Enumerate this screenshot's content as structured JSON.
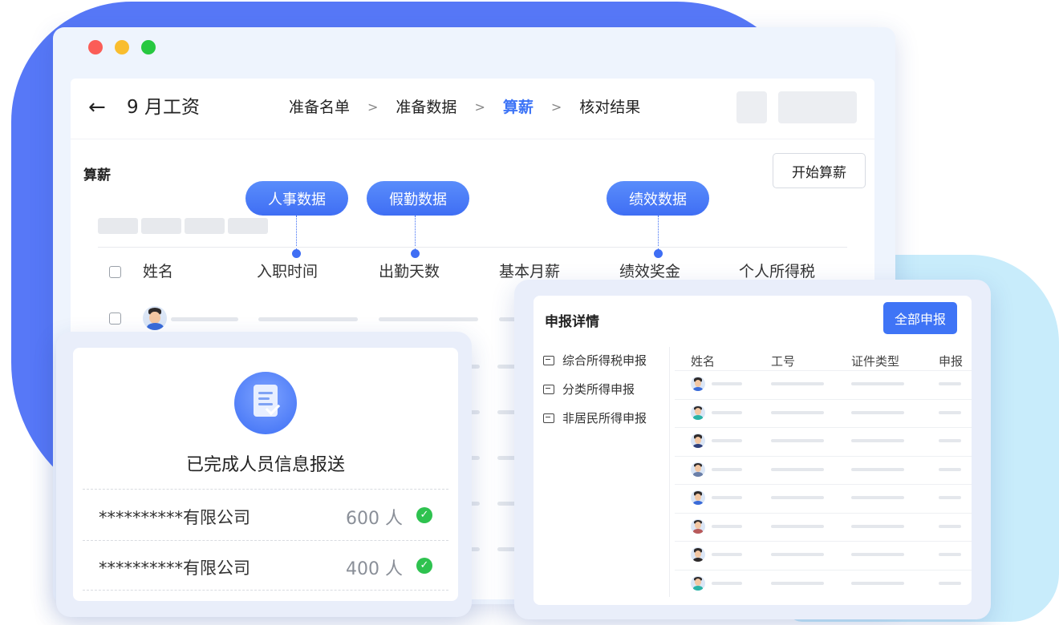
{
  "header": {
    "back_icon": "←",
    "title": "9 月工资",
    "steps": [
      {
        "label": "准备名单",
        "active": false
      },
      {
        "label": "准备数据",
        "active": false
      },
      {
        "label": "算薪",
        "active": true
      },
      {
        "label": "核对结果",
        "active": false
      }
    ],
    "step_separator": ">"
  },
  "section": {
    "title": "算薪",
    "start_button": "开始算薪"
  },
  "tags": [
    "人事数据",
    "假勤数据",
    "绩效数据"
  ],
  "table": {
    "columns": [
      "姓名",
      "入职时间",
      "出勤天数",
      "基本月薪",
      "绩效奖金",
      "个人所得税"
    ]
  },
  "report_card": {
    "title": "已完成人员信息报送",
    "rows": [
      {
        "company": "**********有限公司",
        "count": "600 人"
      },
      {
        "company": "**********有限公司",
        "count": "400 人"
      }
    ],
    "check_icon": "check-circle-icon"
  },
  "declare_card": {
    "title": "申报详情",
    "button": "全部申报",
    "nav": [
      "综合所得税申报",
      "分类所得申报",
      "非居民所得申报"
    ],
    "columns": [
      "姓名",
      "工号",
      "证件类型",
      "申报"
    ]
  },
  "colors": {
    "accent": "#3f74f6",
    "blob_blue": "#5778f7",
    "blob_cyan": "#c8ecfb",
    "success": "#2ec24f"
  }
}
